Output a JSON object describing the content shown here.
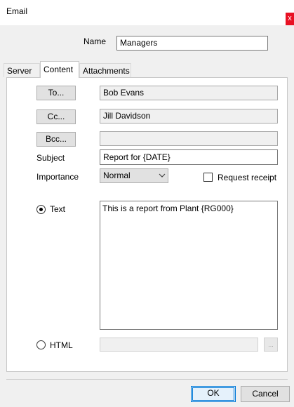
{
  "window": {
    "title": "Email",
    "close_glyph": "x"
  },
  "form": {
    "name_label": "Name",
    "name_value": "Managers"
  },
  "tabs": [
    {
      "label": "Server"
    },
    {
      "label": "Content",
      "active": true
    },
    {
      "label": "Attachments"
    }
  ],
  "recipients": {
    "to_button": "To...",
    "to_value": "Bob Evans",
    "cc_button": "Cc...",
    "cc_value": "Jill Davidson",
    "bcc_button": "Bcc...",
    "bcc_value": ""
  },
  "subject": {
    "label": "Subject",
    "value": "Report for {DATE}"
  },
  "importance": {
    "label": "Importance",
    "selected": "Normal"
  },
  "request_receipt": {
    "label": "Request receipt",
    "checked": false
  },
  "body": {
    "text_radio_label": "Text",
    "text_selected": true,
    "text_value": "This is a report from Plant {RG000}",
    "html_radio_label": "HTML",
    "html_value": "",
    "browse_label": "..."
  },
  "footer": {
    "ok_label": "OK",
    "cancel_label": "Cancel"
  },
  "colors": {
    "dialog_bg": "#f0f0f0",
    "close_red": "#e81123",
    "focus_blue": "#0078d7"
  }
}
